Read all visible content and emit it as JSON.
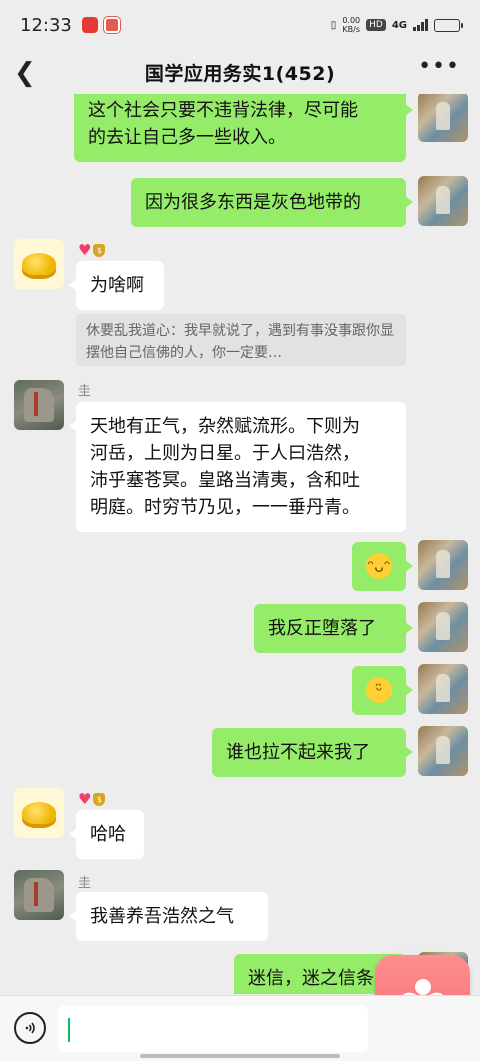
{
  "status_bar": {
    "time": "12:33",
    "net_speed_value": "0.00",
    "net_speed_unit": "KB/s",
    "hd": "HD",
    "network": "4G",
    "battery_level": 0.7
  },
  "header": {
    "title": "国学应用务实1(452)",
    "back_icon": "chevron-left-icon",
    "more_icon": "ellipsis-icon"
  },
  "messages": [
    {
      "side": "right",
      "text_lines": [
        "这个社会只要不违背法律，尽可能",
        "的去让自己多一些收入。"
      ]
    },
    {
      "side": "right",
      "text": "因为很多东西是灰色地带的"
    },
    {
      "side": "left",
      "sender": "",
      "text": "为啥啊",
      "quote": "休要乱我道心：我早就说了，遇到有事没事跟你显摆他自己信佛的人，你一定要…"
    },
    {
      "side": "left",
      "sender": "圭",
      "text_lines": [
        "天地有正气，杂然赋流形。下则为",
        "河岳，上则为日星。于人曰浩然，",
        "沛乎塞苍冥。皇路当清夷，含和吐",
        "明庭。时穷节乃见，一一垂丹青。"
      ]
    },
    {
      "side": "right",
      "emoji": "grin-emoji"
    },
    {
      "side": "right",
      "text": "我反正堕落了"
    },
    {
      "side": "right",
      "emoji": "thinking-emoji"
    },
    {
      "side": "right",
      "text": "谁也拉不起来我了"
    },
    {
      "side": "left",
      "sender": "",
      "text": "哈哈"
    },
    {
      "side": "left",
      "sender": "圭",
      "text": "我善养吾浩然之气"
    },
    {
      "side": "right",
      "text": "迷信，迷之信条"
    }
  ],
  "colors": {
    "self_bubble": "#95ec69",
    "other_bubble": "#ffffff",
    "background": "#ededed"
  }
}
